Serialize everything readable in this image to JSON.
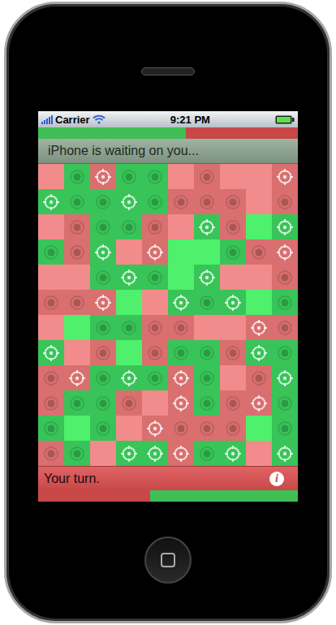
{
  "status_bar": {
    "carrier": "Carrier",
    "time": "9:21 PM",
    "signal_level": 1,
    "battery_level": 1
  },
  "top_bar": {
    "level": 0.57,
    "fill_color": "#3fbf55",
    "track_color": "#c84848"
  },
  "banner": {
    "message": "iPhone is waiting on you..."
  },
  "grid": {
    "rows": [
      [
        {
          "kind": "plain",
          "color": "#f28b8b"
        },
        {
          "kind": "dot",
          "color": "#38c458"
        },
        {
          "kind": "target",
          "color": "#d96f6f"
        },
        {
          "kind": "dot",
          "color": "#38c458"
        },
        {
          "kind": "dot",
          "color": "#38c458"
        },
        {
          "kind": "plain",
          "color": "#f28b8b"
        },
        {
          "kind": "dot",
          "color": "#d96f6f"
        },
        {
          "kind": "plain",
          "color": "#f28b8b"
        },
        {
          "kind": "plain",
          "color": "#f28b8b"
        },
        {
          "kind": "target",
          "color": "#d96f6f"
        }
      ],
      [
        {
          "kind": "target",
          "color": "#38c458"
        },
        {
          "kind": "dot",
          "color": "#38c458"
        },
        {
          "kind": "dot",
          "color": "#38c458"
        },
        {
          "kind": "target",
          "color": "#38c458"
        },
        {
          "kind": "dot",
          "color": "#38c458"
        },
        {
          "kind": "dot",
          "color": "#d96f6f"
        },
        {
          "kind": "dot",
          "color": "#d96f6f"
        },
        {
          "kind": "dot",
          "color": "#d96f6f"
        },
        {
          "kind": "plain",
          "color": "#f28b8b"
        },
        {
          "kind": "dot",
          "color": "#d96f6f"
        }
      ],
      [
        {
          "kind": "plain",
          "color": "#f28b8b"
        },
        {
          "kind": "dot",
          "color": "#d96f6f"
        },
        {
          "kind": "dot",
          "color": "#38c458"
        },
        {
          "kind": "dot",
          "color": "#38c458"
        },
        {
          "kind": "dot",
          "color": "#d96f6f"
        },
        {
          "kind": "plain",
          "color": "#f28b8b"
        },
        {
          "kind": "target",
          "color": "#38c458"
        },
        {
          "kind": "dot",
          "color": "#d96f6f"
        },
        {
          "kind": "plain",
          "color": "#4ef06c"
        },
        {
          "kind": "target",
          "color": "#38c458"
        }
      ],
      [
        {
          "kind": "dot",
          "color": "#38c458"
        },
        {
          "kind": "dot",
          "color": "#d96f6f"
        },
        {
          "kind": "target",
          "color": "#38c458"
        },
        {
          "kind": "plain",
          "color": "#f28b8b"
        },
        {
          "kind": "target",
          "color": "#d96f6f"
        },
        {
          "kind": "plain",
          "color": "#4ef06c"
        },
        {
          "kind": "plain",
          "color": "#4ef06c"
        },
        {
          "kind": "dot",
          "color": "#38c458"
        },
        {
          "kind": "dot",
          "color": "#d96f6f"
        },
        {
          "kind": "target",
          "color": "#d96f6f"
        }
      ],
      [
        {
          "kind": "plain",
          "color": "#f28b8b"
        },
        {
          "kind": "plain",
          "color": "#f28b8b"
        },
        {
          "kind": "dot",
          "color": "#38c458"
        },
        {
          "kind": "target",
          "color": "#38c458"
        },
        {
          "kind": "dot",
          "color": "#38c458"
        },
        {
          "kind": "plain",
          "color": "#4ef06c"
        },
        {
          "kind": "target",
          "color": "#38c458"
        },
        {
          "kind": "plain",
          "color": "#f28b8b"
        },
        {
          "kind": "plain",
          "color": "#f28b8b"
        },
        {
          "kind": "dot",
          "color": "#d96f6f"
        }
      ],
      [
        {
          "kind": "dot",
          "color": "#d96f6f"
        },
        {
          "kind": "dot",
          "color": "#d96f6f"
        },
        {
          "kind": "target",
          "color": "#d96f6f"
        },
        {
          "kind": "plain",
          "color": "#4ef06c"
        },
        {
          "kind": "plain",
          "color": "#f28b8b"
        },
        {
          "kind": "target",
          "color": "#38c458"
        },
        {
          "kind": "dot",
          "color": "#38c458"
        },
        {
          "kind": "target",
          "color": "#38c458"
        },
        {
          "kind": "plain",
          "color": "#4ef06c"
        },
        {
          "kind": "dot",
          "color": "#38c458"
        }
      ],
      [
        {
          "kind": "plain",
          "color": "#f28b8b"
        },
        {
          "kind": "plain",
          "color": "#4ef06c"
        },
        {
          "kind": "dot",
          "color": "#38c458"
        },
        {
          "kind": "dot",
          "color": "#38c458"
        },
        {
          "kind": "dot",
          "color": "#d96f6f"
        },
        {
          "kind": "dot",
          "color": "#d96f6f"
        },
        {
          "kind": "plain",
          "color": "#f28b8b"
        },
        {
          "kind": "plain",
          "color": "#f28b8b"
        },
        {
          "kind": "target",
          "color": "#d96f6f"
        },
        {
          "kind": "dot",
          "color": "#d96f6f"
        }
      ],
      [
        {
          "kind": "target",
          "color": "#38c458"
        },
        {
          "kind": "plain",
          "color": "#f28b8b"
        },
        {
          "kind": "dot",
          "color": "#d96f6f"
        },
        {
          "kind": "plain",
          "color": "#4ef06c"
        },
        {
          "kind": "dot",
          "color": "#d96f6f"
        },
        {
          "kind": "dot",
          "color": "#38c458"
        },
        {
          "kind": "dot",
          "color": "#38c458"
        },
        {
          "kind": "dot",
          "color": "#d96f6f"
        },
        {
          "kind": "target",
          "color": "#38c458"
        },
        {
          "kind": "dot",
          "color": "#38c458"
        }
      ],
      [
        {
          "kind": "dot",
          "color": "#d96f6f"
        },
        {
          "kind": "target",
          "color": "#d96f6f"
        },
        {
          "kind": "dot",
          "color": "#38c458"
        },
        {
          "kind": "target",
          "color": "#38c458"
        },
        {
          "kind": "dot",
          "color": "#38c458"
        },
        {
          "kind": "target",
          "color": "#d96f6f"
        },
        {
          "kind": "dot",
          "color": "#38c458"
        },
        {
          "kind": "plain",
          "color": "#f28b8b"
        },
        {
          "kind": "dot",
          "color": "#d96f6f"
        },
        {
          "kind": "target",
          "color": "#38c458"
        }
      ],
      [
        {
          "kind": "dot",
          "color": "#d96f6f"
        },
        {
          "kind": "dot",
          "color": "#38c458"
        },
        {
          "kind": "dot",
          "color": "#38c458"
        },
        {
          "kind": "dot",
          "color": "#d96f6f"
        },
        {
          "kind": "plain",
          "color": "#f28b8b"
        },
        {
          "kind": "target",
          "color": "#d96f6f"
        },
        {
          "kind": "dot",
          "color": "#38c458"
        },
        {
          "kind": "dot",
          "color": "#d96f6f"
        },
        {
          "kind": "target",
          "color": "#d96f6f"
        },
        {
          "kind": "dot",
          "color": "#38c458"
        }
      ],
      [
        {
          "kind": "dot",
          "color": "#38c458"
        },
        {
          "kind": "plain",
          "color": "#4ef06c"
        },
        {
          "kind": "dot",
          "color": "#38c458"
        },
        {
          "kind": "plain",
          "color": "#f28b8b"
        },
        {
          "kind": "target",
          "color": "#d96f6f"
        },
        {
          "kind": "dot",
          "color": "#d96f6f"
        },
        {
          "kind": "dot",
          "color": "#d96f6f"
        },
        {
          "kind": "dot",
          "color": "#d96f6f"
        },
        {
          "kind": "plain",
          "color": "#4ef06c"
        },
        {
          "kind": "dot",
          "color": "#38c458"
        }
      ],
      [
        {
          "kind": "dot",
          "color": "#d96f6f"
        },
        {
          "kind": "dot",
          "color": "#38c458"
        },
        {
          "kind": "plain",
          "color": "#f28b8b"
        },
        {
          "kind": "target",
          "color": "#38c458"
        },
        {
          "kind": "target",
          "color": "#38c458"
        },
        {
          "kind": "target",
          "color": "#d96f6f"
        },
        {
          "kind": "dot",
          "color": "#38c458"
        },
        {
          "kind": "target",
          "color": "#38c458"
        },
        {
          "kind": "plain",
          "color": "#f28b8b"
        },
        {
          "kind": "target",
          "color": "#38c458"
        }
      ]
    ]
  },
  "turn_bar": {
    "message": "Your turn.",
    "info": "i"
  },
  "bottom_bar": {
    "level": 0.43,
    "fill_color": "#c84848",
    "track_color": "#3fbf55"
  }
}
